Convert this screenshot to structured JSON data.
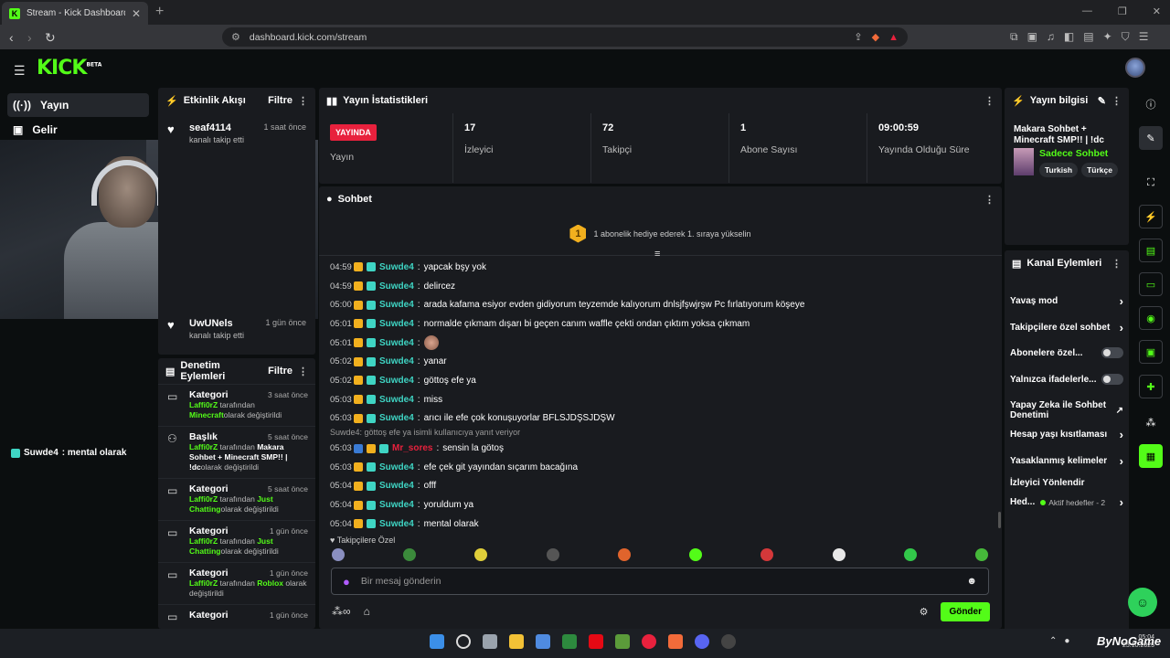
{
  "browser": {
    "tab_title": "Stream - Kick Dashboard",
    "url": "dashboard.kick.com/stream"
  },
  "header": {
    "logo": "KICK",
    "logo_badge": "BETA"
  },
  "nav": {
    "items": [
      {
        "label": "Yayın",
        "icon": "broadcast-icon"
      },
      {
        "label": "Gelir",
        "icon": "wallet-icon"
      }
    ]
  },
  "webcam_chat": {
    "user": "Suwde4",
    "text": ": mental olarak"
  },
  "activity": {
    "title": "Etkinlik Akışı",
    "filter": "Filtre",
    "items": [
      {
        "name": "seaf4114",
        "time": "1 saat önce",
        "sub": "kanalı takip etti"
      },
      {
        "name": "UwUNels",
        "time": "1 gün önce",
        "sub": "kanalı takip etti"
      }
    ]
  },
  "modlog": {
    "title": "Denetim Eylemleri",
    "filter": "Filtre",
    "items": [
      {
        "type": "Kategori",
        "time": "3 saat önce",
        "by": "Laffi0rZ",
        "mid": " tarafından ",
        "target": "Minecraft",
        "end": "olarak değiştirildi"
      },
      {
        "type": "Başlık",
        "time": "5 saat önce",
        "by": "Laffi0rZ",
        "mid": " tarafından ",
        "target": "Makara Sohbet + Minecraft SMP!! | !dc",
        "end": "olarak değiştirildi"
      },
      {
        "type": "Kategori",
        "time": "5 saat önce",
        "by": "Laffi0rZ",
        "mid": " tarafından ",
        "target": "Just Chatting",
        "end": "olarak değiştirildi"
      },
      {
        "type": "Kategori",
        "time": "1 gün önce",
        "by": "Laffi0rZ",
        "mid": " tarafından ",
        "target": "Just Chatting",
        "end": "olarak değiştirildi"
      },
      {
        "type": "Kategori",
        "time": "1 gün önce",
        "by": "Laffi0rZ",
        "mid": " tarafından ",
        "target": "Roblox",
        "end": " olarak değiştirildi"
      },
      {
        "type": "Kategori",
        "time": "1 gün önce",
        "by": "",
        "mid": "",
        "target": "",
        "end": ""
      }
    ]
  },
  "stats": {
    "title": "Yayın İstatistikleri",
    "live_badge": "YAYINDA",
    "cells": [
      {
        "value": "",
        "label": "Yayın"
      },
      {
        "value": "17",
        "label": "İzleyici"
      },
      {
        "value": "72",
        "label": "Takipçi"
      },
      {
        "value": "1",
        "label": "Abone Sayısı"
      },
      {
        "value": "09:00:59",
        "label": "Yayında Olduğu Süre"
      }
    ]
  },
  "chat": {
    "title": "Sohbet",
    "pinned_rank": "1",
    "pinned": "1 abonelik hediye ederek 1. sıraya yükselin",
    "messages": [
      {
        "time": "04:59",
        "user": "Suwde4",
        "text": "yapcak bşy yok"
      },
      {
        "time": "04:59",
        "user": "Suwde4",
        "text": "delircez"
      },
      {
        "time": "05:00",
        "user": "Suwde4",
        "text": "arada kafama esiyor evden gidiyorum teyzemde kalıyorum dnlsjfşwjrşw Pc fırlatıyorum köşeye"
      },
      {
        "time": "05:01",
        "user": "Suwde4",
        "text": "normalde çıkmam dışarı bi geçen canım waffle çekti ondan çıktım yoksa çıkmam"
      },
      {
        "time": "05:01",
        "user": "Suwde4",
        "text": "",
        "emote": true
      },
      {
        "time": "05:02",
        "user": "Suwde4",
        "text": "yanar"
      },
      {
        "time": "05:02",
        "user": "Suwde4",
        "text": "göttoş efe ya"
      },
      {
        "time": "05:03",
        "user": "Suwde4",
        "text": "miss"
      },
      {
        "time": "05:03",
        "user": "Suwde4",
        "text": "arıcı ile efe çok konuşuyorlar BFLSJDŞSJDŞW"
      }
    ],
    "reply_note": "Suwde4: göttoş efe ya isimli kullanıcıya yanıt veriyor",
    "messages2": [
      {
        "time": "05:03",
        "user": "Mr_sores",
        "text": "sensin la götoş",
        "red": true
      },
      {
        "time": "05:03",
        "user": "Suwde4",
        "text": "efe çek git yayından sıçarım bacağına"
      },
      {
        "time": "05:04",
        "user": "Suwde4",
        "text": "offf"
      },
      {
        "time": "05:04",
        "user": "Suwde4",
        "text": "yoruldum ya"
      },
      {
        "time": "05:04",
        "user": "Suwde4",
        "text": "mental olarak"
      }
    ],
    "follow_only": "Takipçilere Özel",
    "input_placeholder": "Bir mesaj gönderin",
    "send": "Gönder"
  },
  "streaminfo": {
    "title": "Yayın bilgisi",
    "stream_title": "Makara Sohbet + Minecraft SMP!! | !dc",
    "category": "Sadece Sohbet",
    "tags": [
      "Turkish",
      "Türkçe"
    ]
  },
  "actions": {
    "title": "Kanal Eylemleri",
    "rows": [
      {
        "label": "Yavaş mod",
        "kind": "chev"
      },
      {
        "label": "Takipçilere özel sohbet",
        "kind": "chev"
      },
      {
        "label": "Abonelere özel...",
        "kind": "toggle"
      },
      {
        "label": "Yalnızca ifadelerle...",
        "kind": "toggle"
      },
      {
        "label": "Yapay Zeka ile Sohbet Denetimi",
        "kind": "ext"
      },
      {
        "label": "Hesap yaşı kısıtlaması",
        "kind": "chev"
      },
      {
        "label": "Yasaklanmış kelimeler",
        "kind": "chev"
      },
      {
        "label": "İzleyici Yönlendir",
        "kind": "none"
      }
    ],
    "goals_label": "Hed...",
    "goals_status": "Aktif hedefler - 2"
  },
  "taskbar": {
    "watermark": "ByNoGame",
    "clock": "05:04",
    "date": "25.10.2025"
  },
  "colors": {
    "brand": "#53fc18",
    "live": "#e8213d",
    "subscriber": "#3fd5c4"
  }
}
